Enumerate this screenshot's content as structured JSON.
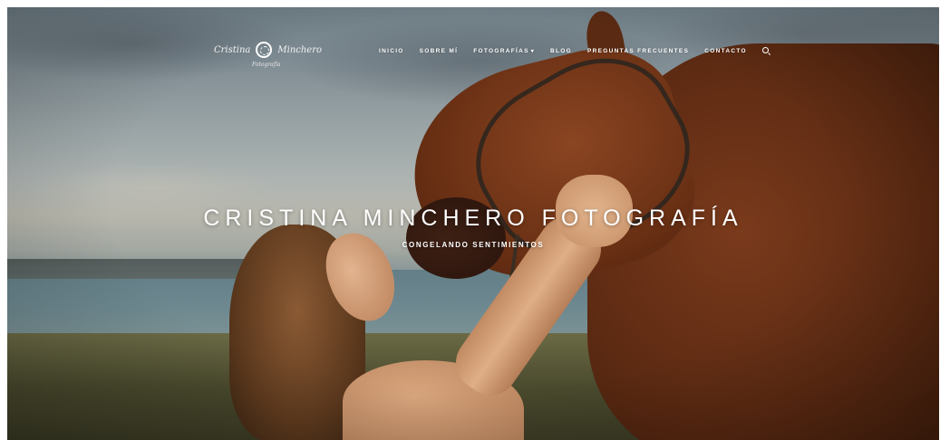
{
  "logo": {
    "left_word": "Cristina",
    "right_word": "Minchero",
    "sub": "Fotografía"
  },
  "nav": {
    "items": [
      {
        "label": "INICIO"
      },
      {
        "label": "SOBRE MÍ"
      },
      {
        "label": "FOTOGRAFÍAS",
        "caret": "▾"
      },
      {
        "label": "BLOG"
      },
      {
        "label": "PREGUNTAS FRECUENTES"
      },
      {
        "label": "CONTACTO"
      }
    ],
    "search_icon": "search-icon"
  },
  "hero": {
    "title": "CRISTINA MINCHERO FOTOGRAFÍA",
    "subtitle": "CONGELANDO SENTIMIENTOS"
  },
  "colors": {
    "text": "#ffffff",
    "horse": "#6a3014",
    "sky": "#9aa4a6"
  }
}
